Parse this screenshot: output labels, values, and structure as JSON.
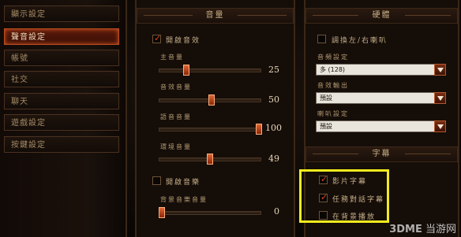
{
  "nav": {
    "items": [
      {
        "label": "顯示設定",
        "active": false
      },
      {
        "label": "聲音設定",
        "active": true
      },
      {
        "label": "帳號",
        "active": false
      },
      {
        "label": "社交",
        "active": false
      },
      {
        "label": "聊天",
        "active": false
      },
      {
        "label": "遊戲設定",
        "active": false
      },
      {
        "label": "按鍵設定",
        "active": false
      }
    ]
  },
  "volume_panel": {
    "header": "音量",
    "enable_sound": {
      "label": "開啟音效",
      "checked": true
    },
    "sliders": [
      {
        "label": "主音量",
        "value": "25"
      },
      {
        "label": "音效音量",
        "value": "50"
      },
      {
        "label": "語音音量",
        "value": "100"
      },
      {
        "label": "環境音量",
        "value": "49"
      }
    ],
    "enable_music": {
      "label": "開啟音樂",
      "checked": false
    },
    "music_slider": {
      "label": "背景音樂音量",
      "value": "0"
    }
  },
  "hardware_panel": {
    "header": "硬體",
    "swap_speakers": {
      "label": "調換左/右喇叭",
      "checked": false
    },
    "selects": [
      {
        "label": "音頻設定",
        "value": "多 (128)"
      },
      {
        "label": "音效輸出",
        "value": "預設"
      },
      {
        "label": "喇叭設定",
        "value": "預設"
      }
    ]
  },
  "subtitle_panel": {
    "header": "字幕",
    "options": [
      {
        "label": "影片字幕",
        "checked": true
      },
      {
        "label": "任務對話字幕",
        "checked": true
      },
      {
        "label": "在背景播放",
        "checked": false
      }
    ]
  },
  "watermark": {
    "logo": "3DME",
    "text": "当游网"
  },
  "colors": {
    "accent": "#d9451c",
    "highlight": "#f3ec1d"
  }
}
